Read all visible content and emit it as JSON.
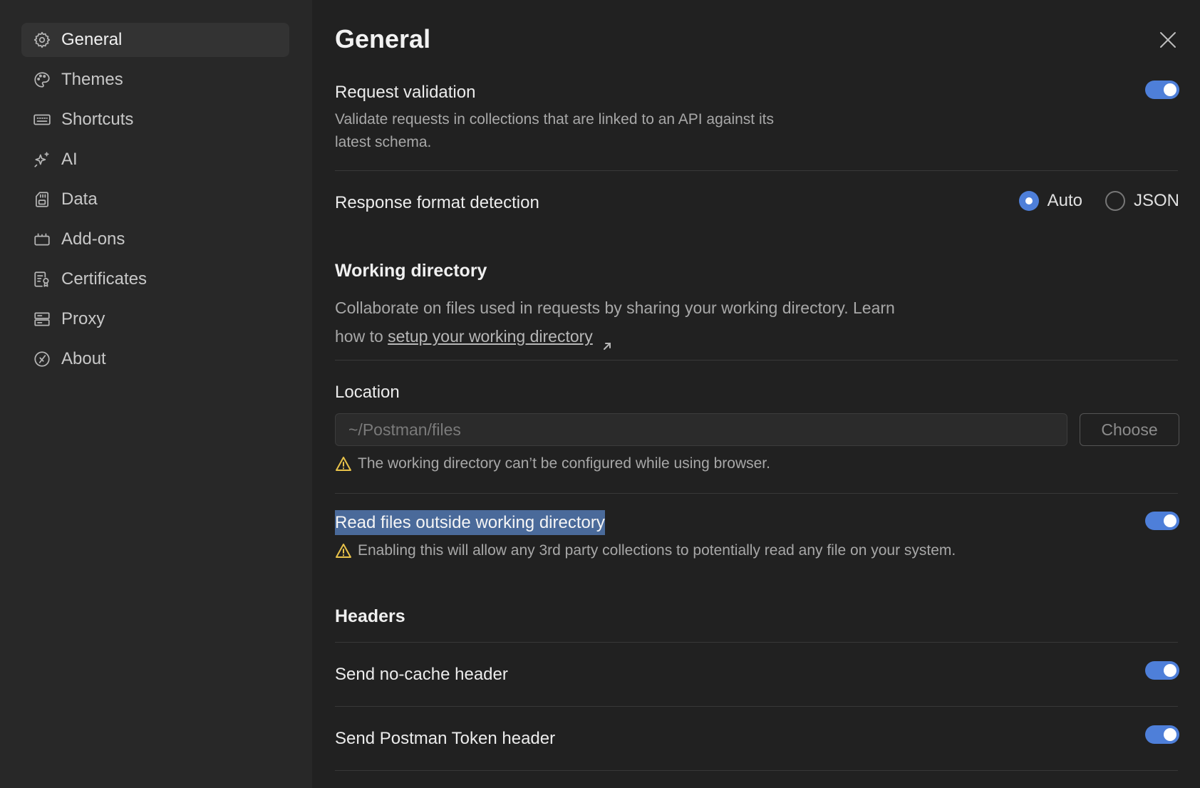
{
  "sidebar": {
    "items": [
      {
        "label": "General",
        "icon": "gear-icon",
        "active": true
      },
      {
        "label": "Themes",
        "icon": "palette-icon"
      },
      {
        "label": "Shortcuts",
        "icon": "keyboard-icon"
      },
      {
        "label": "AI",
        "icon": "sparkle-icon"
      },
      {
        "label": "Data",
        "icon": "sd-card-icon"
      },
      {
        "label": "Add-ons",
        "icon": "addons-icon"
      },
      {
        "label": "Certificates",
        "icon": "certificate-icon"
      },
      {
        "label": "Proxy",
        "icon": "server-icon"
      },
      {
        "label": "About",
        "icon": "postman-logo-icon"
      }
    ]
  },
  "page": {
    "title": "General"
  },
  "request_validation": {
    "title": "Request validation",
    "desc_line1": "Validate requests in collections that are linked to an API against its",
    "desc_line2": "latest schema.",
    "enabled": true
  },
  "response_format": {
    "title": "Response format detection",
    "options": [
      {
        "label": "Auto",
        "checked": true
      },
      {
        "label": "JSON",
        "checked": false
      }
    ]
  },
  "working_directory": {
    "title": "Working directory",
    "desc_line1": "Collaborate on files used in requests by sharing your working directory. Learn",
    "desc_prefix": "how to",
    "link_text": "setup your working directory"
  },
  "location": {
    "title": "Location",
    "placeholder": "~/Postman/files",
    "choose_label": "Choose",
    "warning": "The working directory can’t be configured while using browser."
  },
  "read_outside": {
    "title": "Read files outside working directory",
    "warning": "Enabling this will allow any 3rd party collections to potentially read any file on your system.",
    "enabled": true
  },
  "headers": {
    "title": "Headers",
    "no_cache": {
      "title": "Send no-cache header",
      "enabled": true
    },
    "postman_token": {
      "title": "Send Postman Token header",
      "enabled": true
    }
  },
  "colors": {
    "accent": "#4e7fd9",
    "warning": "#e8c24a",
    "background": "#212121",
    "sidebar": "#282828"
  }
}
